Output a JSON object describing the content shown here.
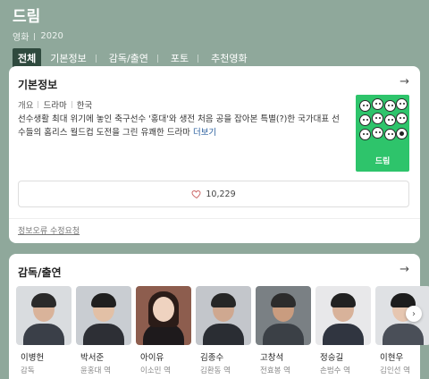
{
  "header": {
    "title": "드림",
    "category": "영화",
    "year": "2020",
    "tabs": [
      {
        "label": "전체",
        "active": true
      },
      {
        "label": "기본정보",
        "active": false
      },
      {
        "label": "감독/출연",
        "active": false
      },
      {
        "label": "포토",
        "active": false
      },
      {
        "label": "추천영화",
        "active": false
      }
    ]
  },
  "info": {
    "title": "기본정보",
    "arrow": "→",
    "tag_label": "개요",
    "genre": "드라마",
    "country": "한국",
    "description": "선수생활 최대 위기에 놓인 축구선수 '홍대'와 생전 처음 공을 잡아본 특별(?)한 국가대표 선수들의 홈리스 월드컵 도전을 그린 유쾌한 드라마",
    "more_label": "더보기",
    "poster_title": "드림",
    "like_count": "10,229",
    "report_label": "정보오류 수정요청"
  },
  "cast": {
    "title": "감독/출연",
    "arrow": "→",
    "next": "›",
    "people": [
      {
        "name": "이병헌",
        "role": "감독",
        "bg": "#d9dcdf",
        "skin": "#d9b39a",
        "hair": "#2a2a2a",
        "cloth": "#3a3f48"
      },
      {
        "name": "박서준",
        "role": "윤홍대 역",
        "bg": "#c9cdd2",
        "skin": "#e2c0a6",
        "hair": "#1f1f1f",
        "cloth": "#2d2f35"
      },
      {
        "name": "아이유",
        "role": "이소민 역",
        "bg": "#8d5d4e",
        "skin": "#efd3c0",
        "hair": "#2b1c18",
        "cloth": "#1e1a1c"
      },
      {
        "name": "김종수",
        "role": "김환동 역",
        "bg": "#c3c6cb",
        "skin": "#cfa890",
        "hair": "#262626",
        "cloth": "#2a2d33"
      },
      {
        "name": "고창석",
        "role": "전효봉 역",
        "bg": "#7a8084",
        "skin": "#c99c7f",
        "hair": "#2c2c2c",
        "cloth": "#3b4046"
      },
      {
        "name": "정승길",
        "role": "손범수 역",
        "bg": "#e8e8ea",
        "skin": "#d8b29a",
        "hair": "#222",
        "cloth": "#303540"
      },
      {
        "name": "이현우",
        "role": "김인선 역",
        "bg": "#dfe1e4",
        "skin": "#e6c6b0",
        "hair": "#1d1d1d",
        "cloth": "#4a4f58"
      }
    ]
  }
}
